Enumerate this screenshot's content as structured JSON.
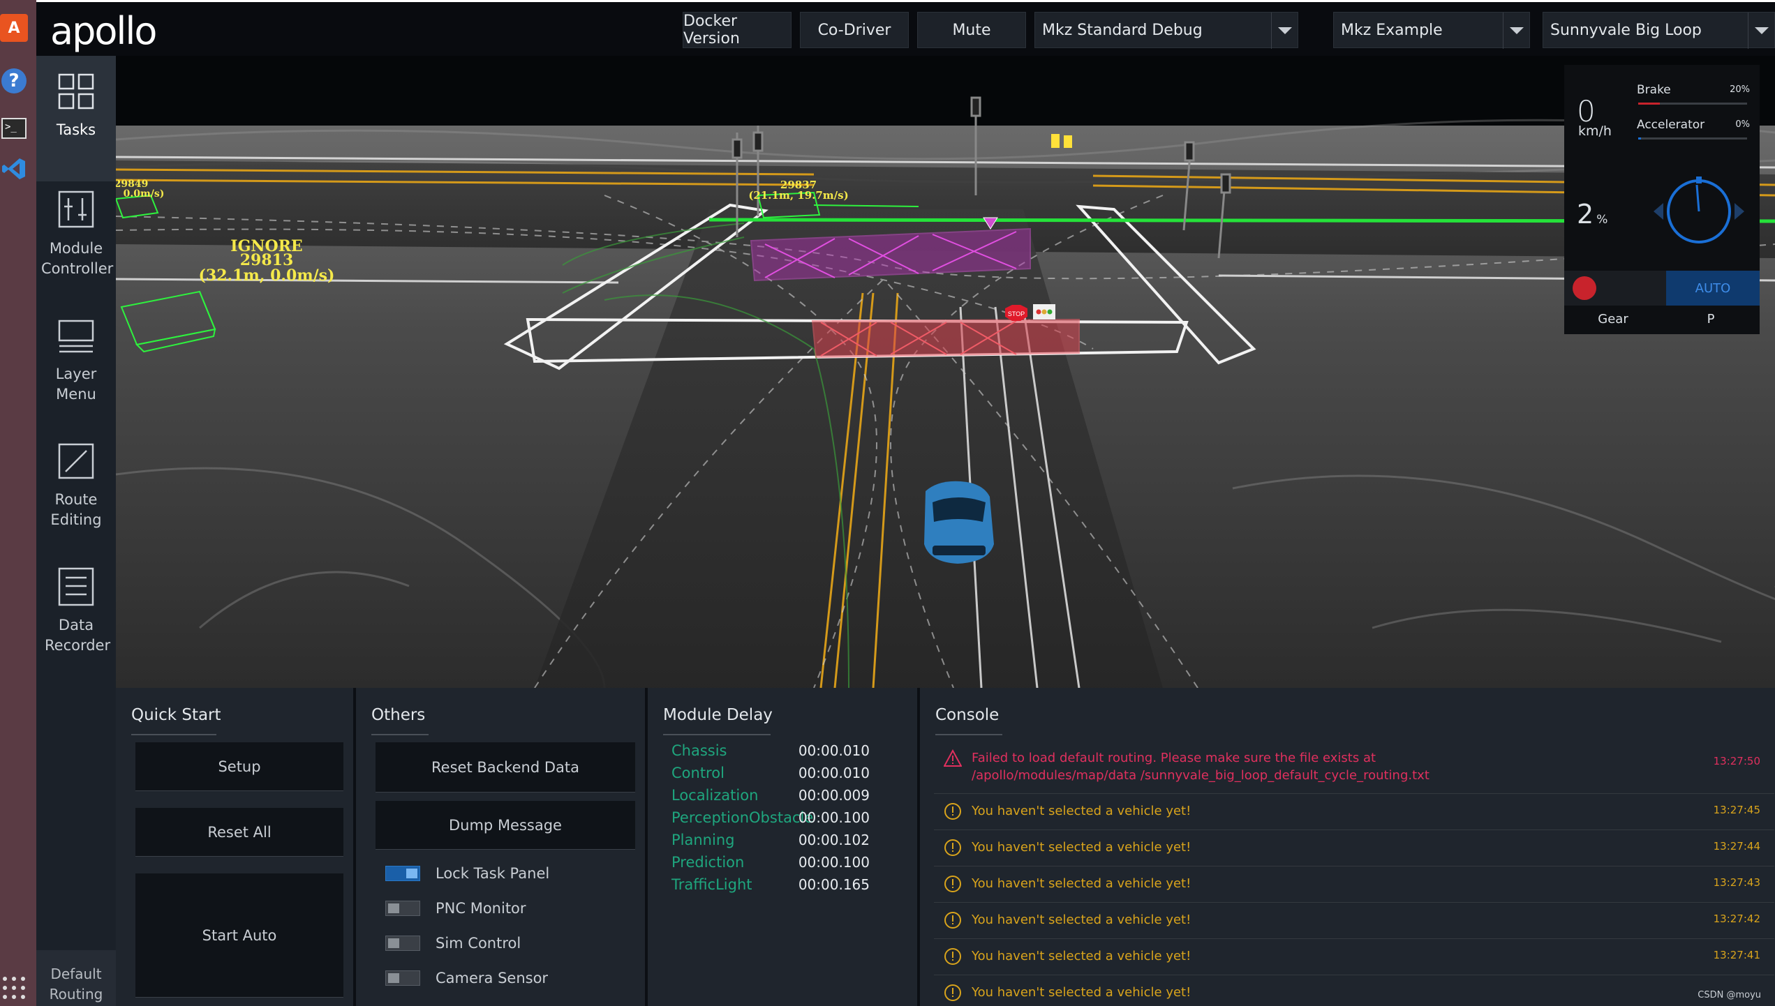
{
  "app": {
    "logo": "apollo"
  },
  "header": {
    "buttons": [
      "Docker Version",
      "Co-Driver",
      "Mute"
    ],
    "selects": [
      {
        "value": "Mkz Standard Debug"
      },
      {
        "value": "Mkz Example"
      },
      {
        "value": "Sunnyvale Big Loop"
      }
    ]
  },
  "sidenav": {
    "items": [
      {
        "label": "Tasks",
        "icon": "grid-icon"
      },
      {
        "label": "Module Controller",
        "icon": "sliders-icon"
      },
      {
        "label": "Layer Menu",
        "icon": "layers-icon"
      },
      {
        "label": "Route Editing",
        "icon": "route-icon"
      },
      {
        "label": "Data Recorder",
        "icon": "document-icon"
      }
    ],
    "bottom": "Default Routing"
  },
  "scene": {
    "obstacles": [
      {
        "label1": "IGNORE",
        "label2": "29813",
        "label3": "(32.1m, 0.0m/s)"
      },
      {
        "label1": "29837",
        "label2": "(21.1m, 19.7m/s)"
      },
      {
        "label1": "29849",
        "label2": "0.0m/s)"
      }
    ],
    "stop_sign": "STOP"
  },
  "hud": {
    "speed": "0",
    "speed_unit": "km/h",
    "brake_label": "Brake",
    "brake_pct": "20%",
    "brake_value": 0.2,
    "accel_label": "Accelerator",
    "accel_pct": "0%",
    "accel_value": 0.0,
    "steering": "2",
    "steering_unit": "%",
    "signal": "RED",
    "mode": "AUTO",
    "gear_label": "Gear",
    "gear_value": "P",
    "colors": {
      "brake": "#c8232c",
      "accel": "#1a6fd6",
      "signal": "#c8232c",
      "auto": "#3e8ce8"
    }
  },
  "quick_start": {
    "title": "Quick Start",
    "buttons": [
      "Setup",
      "Reset All",
      "Start Auto"
    ]
  },
  "others": {
    "title": "Others",
    "buttons": [
      "Reset Backend Data",
      "Dump Message"
    ],
    "toggles": [
      {
        "label": "Lock Task Panel",
        "on": true
      },
      {
        "label": "PNC Monitor",
        "on": false
      },
      {
        "label": "Sim Control",
        "on": false
      },
      {
        "label": "Camera Sensor",
        "on": false
      }
    ]
  },
  "module_delay": {
    "title": "Module Delay",
    "rows": [
      {
        "name": "Chassis",
        "value": "00:00.010"
      },
      {
        "name": "Control",
        "value": "00:00.010"
      },
      {
        "name": "Localization",
        "value": "00:00.009"
      },
      {
        "name": "PerceptionObstacle",
        "value": "00:00.100"
      },
      {
        "name": "Planning",
        "value": "00:00.102"
      },
      {
        "name": "Prediction",
        "value": "00:00.100"
      },
      {
        "name": "TrafficLight",
        "value": "00:00.165"
      }
    ]
  },
  "console": {
    "title": "Console",
    "messages": [
      {
        "level": "error",
        "text": "Failed to load default routing. Please make sure the file exists at /apollo/modules/map/data /sunnyvale_big_loop_default_cycle_routing.txt",
        "time": "13:27:50"
      },
      {
        "level": "warning",
        "text": "You haven't selected a vehicle yet!",
        "time": "13:27:45"
      },
      {
        "level": "warning",
        "text": "You haven't selected a vehicle yet!",
        "time": "13:27:44"
      },
      {
        "level": "warning",
        "text": "You haven't selected a vehicle yet!",
        "time": "13:27:43"
      },
      {
        "level": "warning",
        "text": "You haven't selected a vehicle yet!",
        "time": "13:27:42"
      },
      {
        "level": "warning",
        "text": "You haven't selected a vehicle yet!",
        "time": "13:27:41"
      },
      {
        "level": "warning",
        "text": "You haven't selected a vehicle yet!",
        "time": ""
      }
    ],
    "watermark": "CSDN @moyu"
  }
}
